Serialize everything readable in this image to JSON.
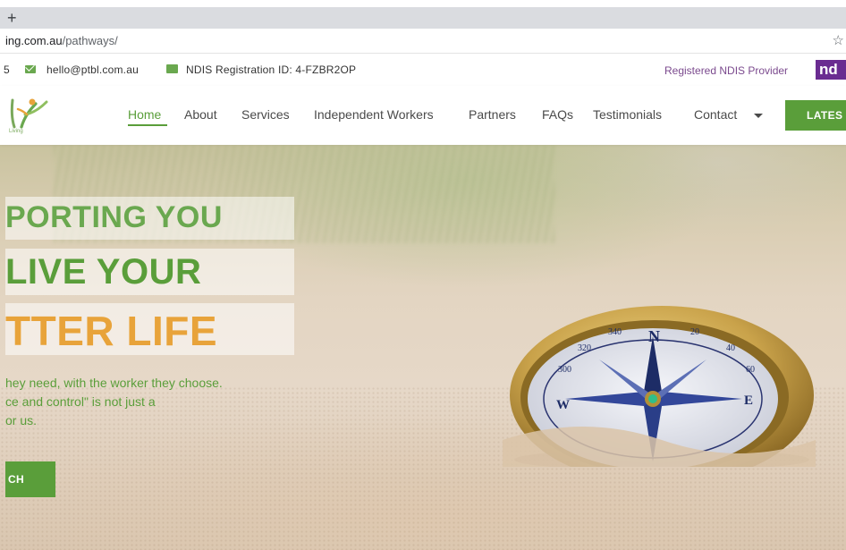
{
  "browser": {
    "new_tab_symbol": "+",
    "url_host": "ing.com.au",
    "url_path": "/pathways/",
    "bookmark_icon": "star-outline-icon"
  },
  "infobar": {
    "phone_fragment": "5",
    "email": "hello@ptbl.com.au",
    "registration_id": "NDIS Registration ID: 4-FZBR2OP",
    "provider_label": "Registered NDIS Provider",
    "ndis_logo_text": "nd",
    "colors": {
      "icon": "#6aa84f",
      "provider": "#7b4a8e",
      "ndis_brand": "#6a2c91"
    }
  },
  "logo": {
    "caption": "Living"
  },
  "nav": {
    "items": [
      {
        "label": "Home",
        "active": true
      },
      {
        "label": "About"
      },
      {
        "label": "Services"
      },
      {
        "label": "Independent Workers"
      },
      {
        "label": "Partners"
      },
      {
        "label": "FAQs"
      },
      {
        "label": "Testimonials"
      },
      {
        "label": "Contact"
      }
    ],
    "latest_button": "LATES",
    "colors": {
      "accent": "#5a9e3a",
      "text": "#4a4a4a"
    }
  },
  "hero": {
    "headline_1": "PORTING YOU",
    "headline_2": "LIVE YOUR",
    "headline_3": "TTER LIFE",
    "subtext_1": "hey need, with the worker they choose.",
    "subtext_2": "ce and control\" is not just a",
    "subtext_3": "or us.",
    "cta_label": "CH",
    "compass_letters": {
      "north": "N",
      "east": "E",
      "west": "W"
    },
    "compass_degrees": [
      "340",
      "20",
      "40",
      "60",
      "320",
      "300"
    ],
    "colors": {
      "green": "#5a9e3a",
      "light_green": "#6aa84f",
      "orange": "#e8a33a",
      "brass": "#c9a24a"
    }
  }
}
